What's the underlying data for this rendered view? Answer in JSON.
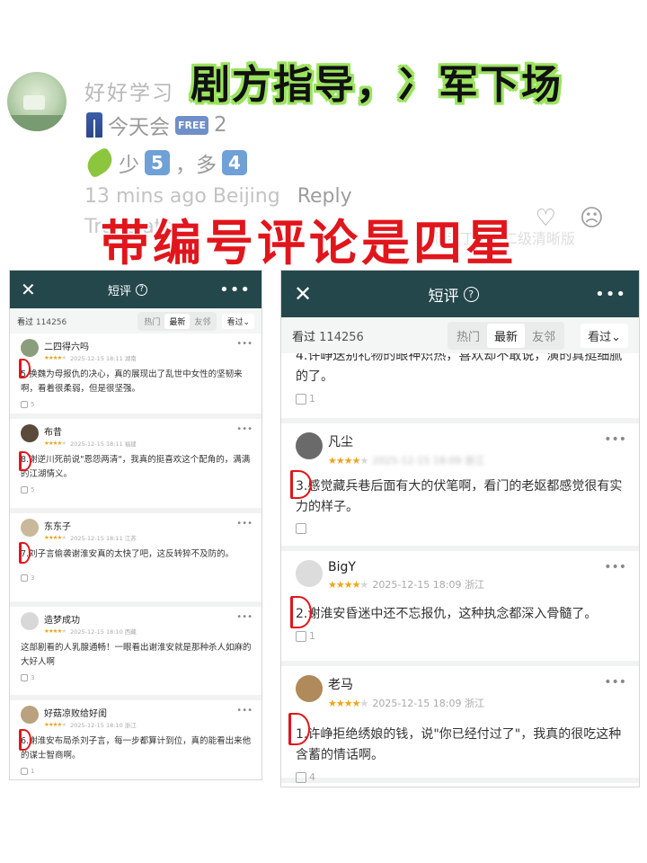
{
  "top_comment": {
    "username": "好好学习",
    "line1_text": "今天会",
    "line1_badge": "FREE",
    "line1_suffix": "2",
    "line2_prefix": "少",
    "line2_badge1": "5",
    "line2_mid": "，多",
    "line2_badge2": "4",
    "time": "13 mins ago Beijing",
    "reply": "Reply",
    "translate": "Translate"
  },
  "overlay": {
    "green_title": "剧方指导，冫军下场",
    "red_title": "带编号评论是四星",
    "watermark": "啊亖丁鱼中二级清晰版"
  },
  "left_panel": {
    "title": "短评",
    "seen_label": "看过",
    "seen_count": "114256",
    "tabs": [
      "热门",
      "最新",
      "友邻"
    ],
    "sort": "看过",
    "items": [
      {
        "name": "二四得六吗",
        "meta": "2025-12-15 18:11 湖南",
        "text": "5.换魏为母报仇的决心，真的展现出了乱世中女性的坚韧来啊，看着很柔弱，但是很坚强。",
        "likes": "5"
      },
      {
        "name": "布昔",
        "meta": "2025-12-15 18:11 福建",
        "text": "8.谢逆川死前说\"恩怨两清\"，我真的挺喜欢这个配角的，满满的江湖情义。",
        "likes": "5"
      },
      {
        "name": "东东子",
        "meta": "2025-12-15 18:11 江苏",
        "text": "7.刘子言偷袭谢淮安真的太快了吧，这反转猝不及防的。",
        "likes": "3"
      },
      {
        "name": "造梦成功",
        "meta": "2025-12-15 18:10 西藏",
        "text": "这部剧看的人乳腺通畅！一眼看出谢淮安就是那种杀人如麻的大好人啊",
        "likes": "3"
      },
      {
        "name": "好菇凉败给好闺",
        "meta": "2025-12-15 18:10 浙江",
        "text": "6.谢淮安布局杀刘子言，每一步都算计到位，真的能看出来他的谋士智商啊。",
        "likes": "1"
      }
    ]
  },
  "right_panel": {
    "title": "短评",
    "seen_label": "看过",
    "seen_count": "114256",
    "tabs": [
      "热门",
      "最新",
      "友邻"
    ],
    "sort": "看过",
    "partial_text": "4.许峥送别礼物的眼神炽热，喜欢却不敢说，演的真挺细腻的了。",
    "partial_likes": "1",
    "items": [
      {
        "name": "凡尘",
        "meta": "2025-12-15 18:09 浙江",
        "text": "3.感觉藏兵巷后面有大的伏笔啊，看门的老妪都感觉很有实力的样子。",
        "likes": ""
      },
      {
        "name": "BigY",
        "meta": "2025-12-15 18:09 浙江",
        "text": "2.谢淮安昏迷中还不忘报仇，这种执念都深入骨髓了。",
        "likes": "1"
      },
      {
        "name": "老马",
        "meta": "2025-12-15 18:09 浙江",
        "text": "1.许峥拒绝绣娘的钱，说\"你已经付过了\"，我真的很吃这种含蓄的情话啊。",
        "likes": "4"
      }
    ]
  },
  "colors": {
    "topbar": "#24474c",
    "stars": "#f0a41c",
    "red": "#e0161c",
    "green": "#9be35e"
  }
}
